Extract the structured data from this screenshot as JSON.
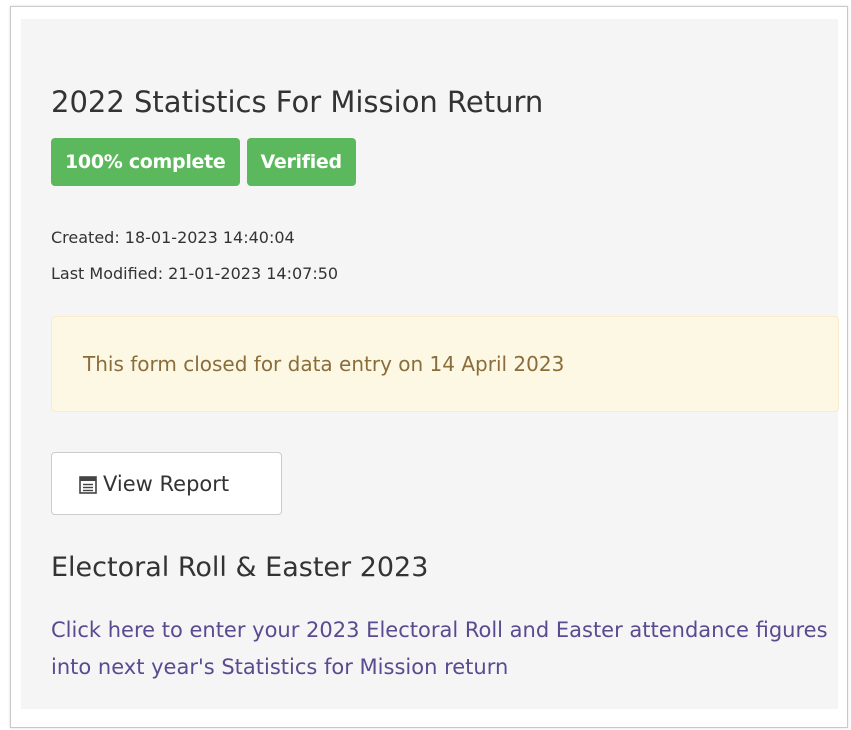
{
  "form": {
    "title": "2022 Statistics For Mission Return",
    "badges": {
      "completion": "100% complete",
      "status": "Verified"
    },
    "created": "Created: 18-01-2023 14:40:04",
    "last_modified": "Last Modified: 21-01-2023 14:07:50",
    "alert_text": "This form closed for data entry on 14 April 2023",
    "view_report_label": "View Report",
    "view_report_icon": "report-icon"
  },
  "next_return": {
    "title": "Electoral Roll & Easter 2023",
    "link_text": "Click here to enter your 2023 Electoral Roll and Easter attendance figures into next year's Statistics for Mission return"
  },
  "colors": {
    "badge_green": "#5cb85c",
    "alert_background": "#fcf8e3",
    "alert_text": "#8a6d3b",
    "link": "#5a4a90",
    "panel_background": "#f5f5f5"
  }
}
